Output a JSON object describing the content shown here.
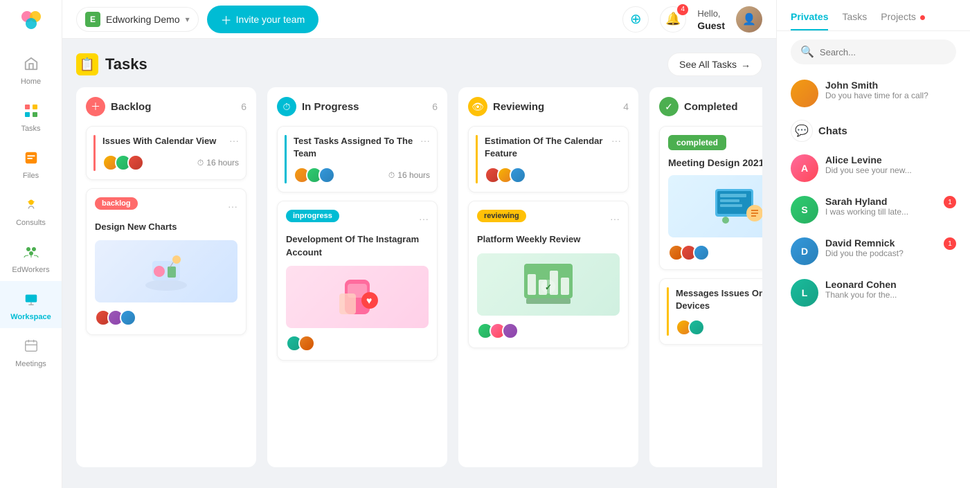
{
  "app": {
    "logo_text": "🎨"
  },
  "sidebar": {
    "items": [
      {
        "id": "home",
        "label": "Home",
        "icon": "🏠",
        "active": false
      },
      {
        "id": "tasks",
        "label": "Tasks",
        "icon": "📋",
        "active": false
      },
      {
        "id": "files",
        "label": "Files",
        "icon": "📁",
        "active": false
      },
      {
        "id": "consults",
        "label": "Consults",
        "icon": "💡",
        "active": false
      },
      {
        "id": "edworkers",
        "label": "EdWorkers",
        "icon": "👥",
        "active": false
      },
      {
        "id": "workspace",
        "label": "Workspace",
        "icon": "💻",
        "active": true
      },
      {
        "id": "meetings",
        "label": "Meetings",
        "icon": "📅",
        "active": false
      }
    ]
  },
  "topbar": {
    "workspace_badge": "E",
    "workspace_name": "Edworking Demo",
    "invite_btn": "Invite your team",
    "notifications_count": "4",
    "greeting_hello": "Hello,",
    "greeting_name": "Guest"
  },
  "board": {
    "title": "Tasks",
    "see_all_label": "See All Tasks",
    "columns": [
      {
        "id": "backlog",
        "name": "Backlog",
        "count": "6",
        "icon_type": "backlog",
        "cards": [
          {
            "id": "c1",
            "title": "Issues With Calendar View",
            "border_color": "#ff6b6b",
            "time": "16 hours",
            "avatars": [
              "av-1",
              "av-2",
              "av-3"
            ]
          },
          {
            "id": "c2",
            "title": "Design New Charts",
            "badge": "backlog",
            "badge_type": "tag-backlog",
            "has_image": true,
            "image_type": "img-design",
            "image_emoji": "👩‍💻",
            "avatars": [
              "av-3",
              "av-4",
              "av-5"
            ]
          }
        ]
      },
      {
        "id": "inprogress",
        "name": "In Progress",
        "count": "6",
        "icon_type": "inprogress",
        "cards": [
          {
            "id": "c3",
            "title": "Test Tasks Assigned To The Team",
            "border_color": "#00bcd4",
            "time": "16 hours",
            "avatars": [
              "av-m",
              "av-2",
              "av-5"
            ]
          },
          {
            "id": "c4",
            "title": "Development Of The Instagram Account",
            "badge": "inprogress",
            "badge_type": "tag-inprogress",
            "has_image": true,
            "image_type": "img-instagram",
            "image_emoji": "📱",
            "avatars": [
              "av-6",
              "av-7"
            ]
          }
        ]
      },
      {
        "id": "reviewing",
        "name": "Reviewing",
        "count": "4",
        "icon_type": "reviewing",
        "cards": [
          {
            "id": "c5",
            "title": "Estimation Of The Calendar Feature",
            "border_color": "#ffc107",
            "avatars": [
              "av-3",
              "av-1",
              "av-5"
            ]
          },
          {
            "id": "c6",
            "title": "Platform Weekly Review",
            "badge": "reviewing",
            "badge_type": "tag-reviewing",
            "has_image": true,
            "image_type": "img-review",
            "image_emoji": "📊",
            "avatars": [
              "av-2",
              "av-8",
              "av-4"
            ]
          }
        ]
      },
      {
        "id": "completed",
        "name": "Completed",
        "count": "",
        "icon_type": "completed",
        "cards": [
          {
            "id": "c7",
            "title": "Meeting Design 2021",
            "badge": "completed",
            "badge_type": "tag-completed",
            "has_image": true,
            "image_type": "img-meeting",
            "image_emoji": "🖥️",
            "avatars": [
              "av-7",
              "av-3",
              "av-5"
            ]
          },
          {
            "id": "c8",
            "title": "Messages Issues On Ios Devices",
            "border_color": "#ffc107",
            "avatars": [
              "av-1",
              "av-6"
            ]
          }
        ]
      }
    ]
  },
  "right_panel": {
    "tabs": [
      {
        "id": "privates",
        "label": "Privates",
        "active": true
      },
      {
        "id": "tasks",
        "label": "Tasks",
        "active": false
      },
      {
        "id": "projects",
        "label": "Projects",
        "active": false,
        "dot": true
      }
    ],
    "search_placeholder": "Search...",
    "chats_section_label": "Chats",
    "contacts": [
      {
        "id": "john",
        "name": "John Smith",
        "preview": "Do you have time for a call?",
        "avatar_class": "av-m",
        "badge": ""
      }
    ],
    "chats": [
      {
        "id": "alice",
        "name": "Alice Levine",
        "preview": "Did you see your new...",
        "avatar_class": "av-8",
        "badge": ""
      },
      {
        "id": "sarah",
        "name": "Sarah Hyland",
        "preview": "I was working till late...",
        "avatar_class": "av-2",
        "badge": "1"
      },
      {
        "id": "david",
        "name": "David Remnick",
        "preview": "Did you the podcast?",
        "avatar_class": "av-5",
        "badge": "1"
      },
      {
        "id": "leonard",
        "name": "Leonard Cohen",
        "preview": "Thank you for the...",
        "avatar_class": "av-6",
        "badge": ""
      }
    ]
  }
}
